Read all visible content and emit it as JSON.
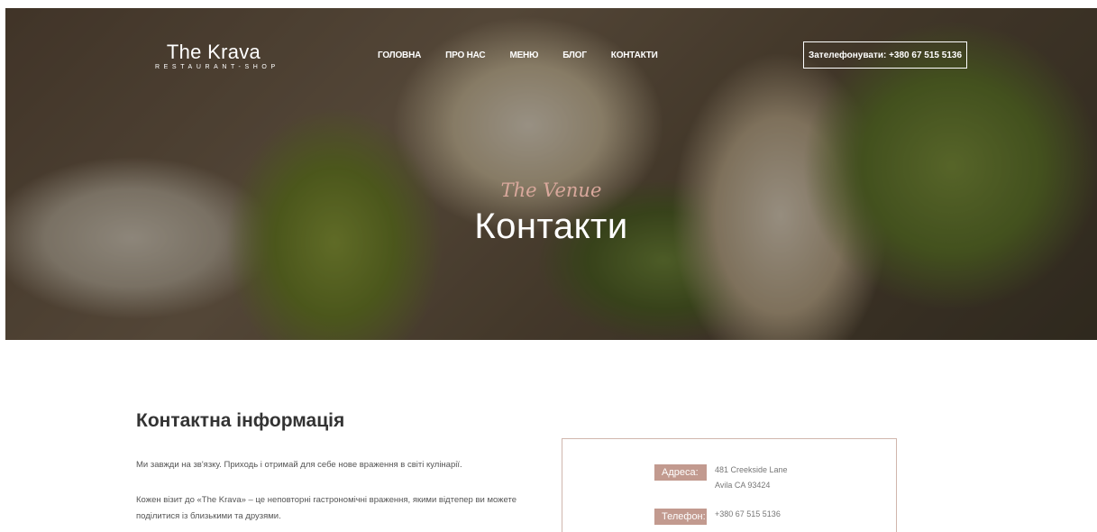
{
  "header": {
    "logo_title": "The Krava",
    "logo_subtitle": "RESTAURANT-SHOP",
    "nav": [
      "ГОЛОВНА",
      "ПРО НАС",
      "МЕНЮ",
      "БЛОГ",
      "КОНТАКТИ"
    ],
    "call_button": "Зателефонувати: +380 67 515 5136"
  },
  "hero": {
    "script_text": "The Venue",
    "title": "Контакти"
  },
  "contact": {
    "heading": "Контактна інформація",
    "paragraph1": "Ми завжди на зв'язку. Приходь і отримай для себе нове враження в світі кулінарії.",
    "paragraph2": "Кожен візит до «The Krava» – це неповторні гастрономічні враження, якими відтепер ви можете поділитися із близькими та друзями.",
    "address_label": "Адреса:",
    "address_line1": "481 Creekside Lane",
    "address_line2": "Avila CA 93424",
    "phone_label": "Телефон:",
    "phone_value": "+380 67 515 5136"
  },
  "colors": {
    "accent": "#c29a8f",
    "script": "#d9a89c",
    "box_border": "#d0b6ad"
  }
}
